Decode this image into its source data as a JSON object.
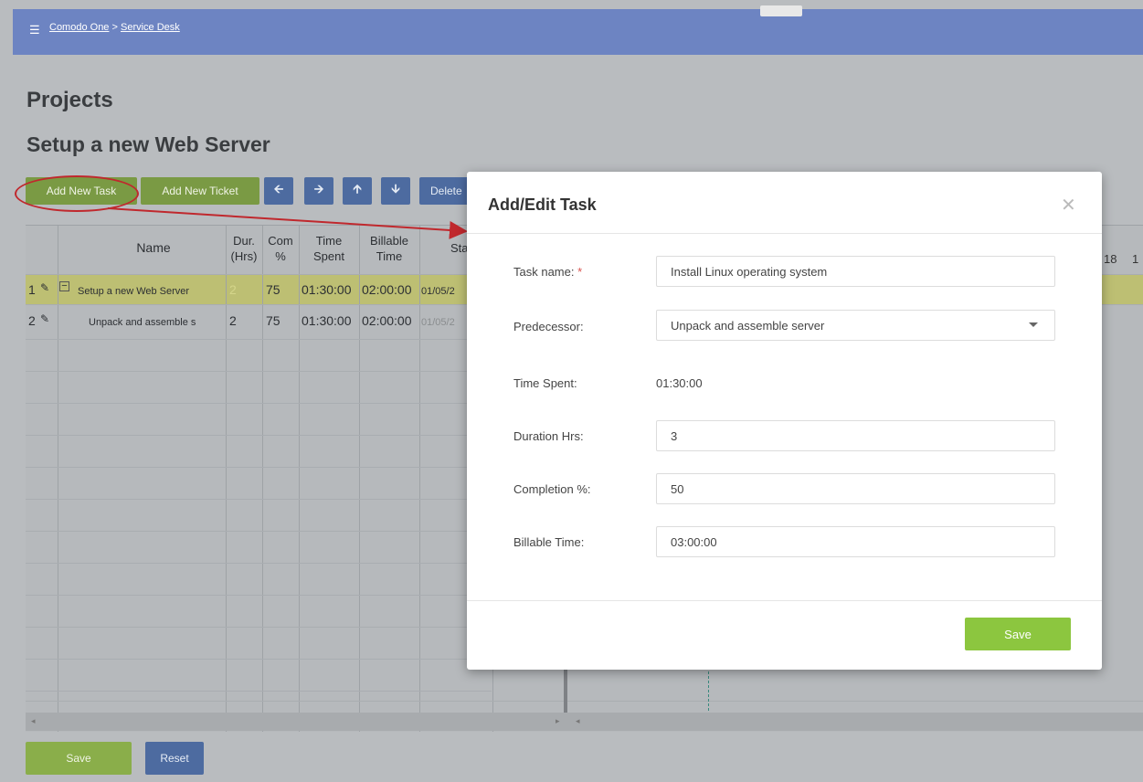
{
  "breadcrumb": {
    "menu_icon": "menu-icon",
    "root": "Comodo One",
    "separator": ">",
    "current": "Service Desk"
  },
  "page_title": "Projects",
  "project_title": "Setup a new Web Server",
  "toolbar": {
    "add_task": "Add New Task",
    "add_ticket": "Add New Ticket",
    "arrows": [
      "arrow-left-icon",
      "arrow-right-icon",
      "arrow-up-icon",
      "arrow-down-icon"
    ],
    "delete": "Delete"
  },
  "grid": {
    "headers": {
      "name": "Name",
      "dur": "Dur. (Hrs)",
      "comp": "Com %",
      "time_spent": "Time Spent",
      "billable": "Billable Time",
      "start": "Star"
    },
    "rows": [
      {
        "num": "1",
        "name": "Setup a new Web Server",
        "dur": "2",
        "comp": "75",
        "time_spent": "01:30:00",
        "billable": "02:00:00",
        "start": "01/05/2"
      },
      {
        "num": "2",
        "name": "Unpack and assemble s",
        "dur": "2",
        "comp": "75",
        "time_spent": "01:30:00",
        "billable": "02:00:00",
        "start": "01/05/2"
      }
    ],
    "timeline_days": [
      "18",
      "1"
    ]
  },
  "footer": {
    "save": "Save",
    "reset": "Reset"
  },
  "modal": {
    "title": "Add/Edit Task",
    "close_icon": "close-icon",
    "task_name_label": "Task name:",
    "required_mark": "*",
    "task_name_value": "Install Linux operating system",
    "predecessor_label": "Predecessor:",
    "predecessor_value": "Unpack and assemble server",
    "time_spent_label": "Time Spent:",
    "time_spent_value": "01:30:00",
    "duration_label": "Duration Hrs:",
    "duration_value": "3",
    "completion_label": "Completion %:",
    "completion_value": "50",
    "billable_label": "Billable Time:",
    "billable_value": "03:00:00",
    "save": "Save"
  },
  "colors": {
    "topbar": "#6d84c2",
    "green_button": "#8cc63f",
    "blue_button": "#4d6ba0",
    "annotation_red": "#c0282d"
  }
}
